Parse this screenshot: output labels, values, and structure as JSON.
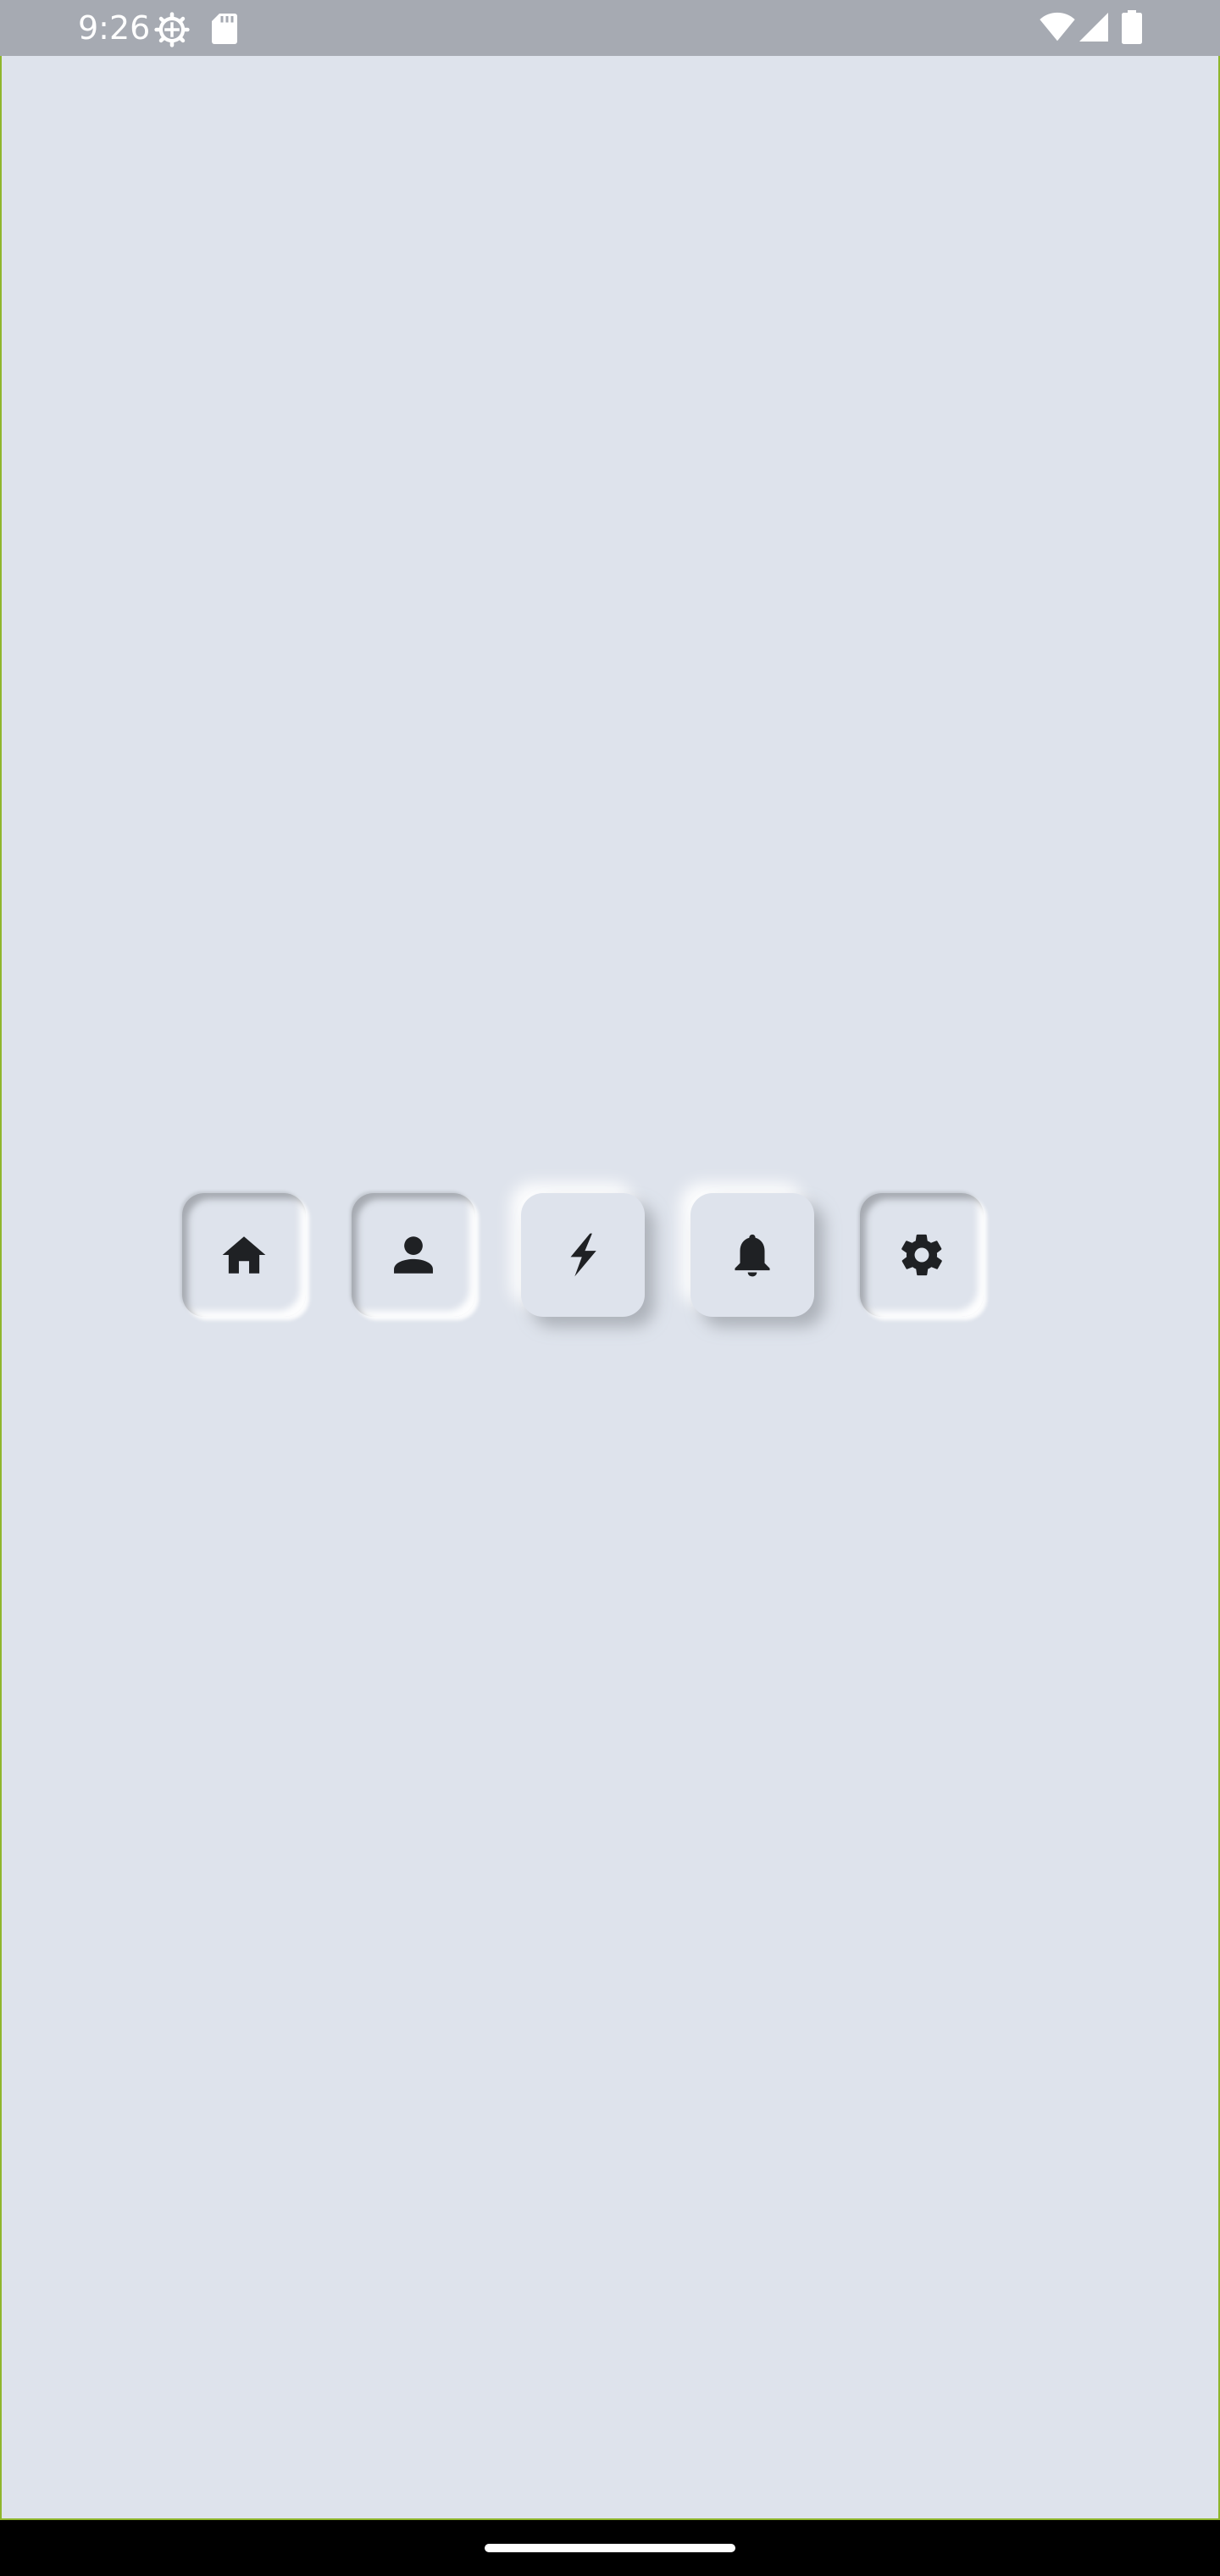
{
  "status_bar": {
    "time": "9:26",
    "left_icons": [
      "settings-status-icon",
      "sd-card-icon"
    ],
    "right_icons": [
      "wifi-icon",
      "cellular-signal-icon",
      "battery-icon"
    ],
    "background_color": "#a6aab2"
  },
  "app": {
    "background_color": "#dee3ec",
    "frame_border_color": "#8fb62d"
  },
  "nav_buttons": [
    {
      "id": "home",
      "icon": "home-icon",
      "state": "pressed"
    },
    {
      "id": "profile",
      "icon": "person-icon",
      "state": "pressed"
    },
    {
      "id": "flash",
      "icon": "lightning-icon",
      "state": "raised"
    },
    {
      "id": "notifications",
      "icon": "bell-icon",
      "state": "raised"
    },
    {
      "id": "settings",
      "icon": "gear-icon",
      "state": "pressed"
    }
  ],
  "icon_color": "#1f2124"
}
